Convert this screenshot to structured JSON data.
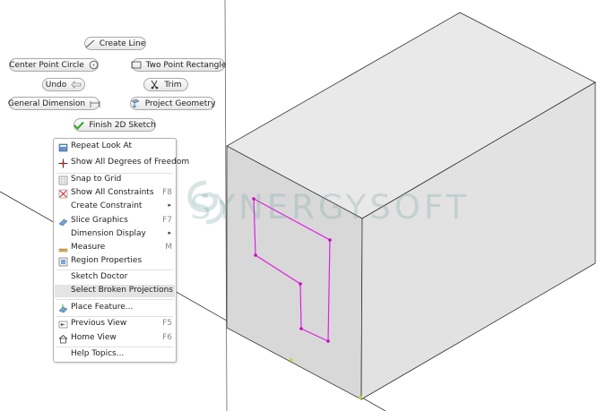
{
  "watermark": {
    "text": "SYNERGYSOFT"
  },
  "buttons": {
    "create_line": "Create Line",
    "center_point_circle": "Center Point Circle",
    "two_point_rectangle": "Two Point Rectangle",
    "undo": "Undo",
    "trim": "Trim",
    "general_dimension": "General Dimension",
    "project_geometry": "Project Geometry",
    "finish_2d_sketch": "Finish 2D Sketch"
  },
  "context_menu": {
    "items": [
      {
        "label": "Repeat Look At",
        "shortcut": "",
        "icon": "repeat-look-at-icon"
      },
      {
        "label": "Show All Degrees of Freedom",
        "shortcut": "",
        "icon": "degrees-of-freedom-icon"
      },
      {
        "label": "Snap to Grid",
        "shortcut": "",
        "icon": "snap-grid-icon"
      },
      {
        "label": "Show All Constraints",
        "shortcut": "F8",
        "icon": "constraints-icon"
      },
      {
        "label": "Create Constraint",
        "shortcut": "▸",
        "icon": ""
      },
      {
        "label": "Slice Graphics",
        "shortcut": "F7",
        "icon": "slice-graphics-icon"
      },
      {
        "label": "Dimension Display",
        "shortcut": "▸",
        "icon": ""
      },
      {
        "label": "Measure",
        "shortcut": "M",
        "icon": "measure-icon"
      },
      {
        "label": "Region Properties",
        "shortcut": "",
        "icon": "region-properties-icon"
      },
      {
        "label": "Sketch Doctor",
        "shortcut": "",
        "icon": ""
      },
      {
        "label": "Select Broken Projections",
        "shortcut": "",
        "icon": ""
      },
      {
        "label": "Place Feature...",
        "shortcut": "",
        "icon": "place-feature-icon"
      },
      {
        "label": "Previous View",
        "shortcut": "F5",
        "icon": "previous-view-icon"
      },
      {
        "label": "Home View",
        "shortcut": "F6",
        "icon": "home-view-icon"
      },
      {
        "label": "Help Topics...",
        "shortcut": "",
        "icon": ""
      }
    ]
  },
  "colors": {
    "sketch_profile": "#e020e0",
    "box_top": "#e8e8e8",
    "box_front": "#d9d9d9",
    "box_side": "#e3e3e3",
    "edge": "#333333",
    "menu_highlight": "#e4e4e4",
    "origin_point": "#c8d830"
  }
}
